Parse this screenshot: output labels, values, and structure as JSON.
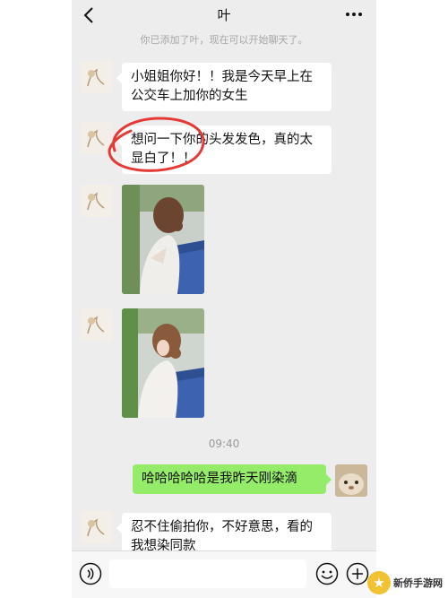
{
  "header": {
    "back_icon": "chevron-left-icon",
    "title": "叶",
    "more_icon": "more-dots-icon"
  },
  "system_notice": "你已添加了叶，现在可以开始聊天了。",
  "messages": [
    {
      "side": "left",
      "type": "text",
      "text": "小姐姐你好！！我是今天早上在公交车上加你的女生"
    },
    {
      "side": "left",
      "type": "text",
      "text": "想问一下你的头发发色，真的太显白了！！"
    },
    {
      "side": "left",
      "type": "image",
      "description_icon": "photo"
    },
    {
      "side": "left",
      "type": "image",
      "description_icon": "photo"
    },
    {
      "side": "right",
      "type": "text",
      "text": "哈哈哈哈哈是我昨天刚染滴"
    },
    {
      "side": "left",
      "type": "text",
      "text": "忍不住偷拍你，不好意思，看的我想染同款"
    }
  ],
  "timestamp": "09:40",
  "input_bar": {
    "voice_icon": "voice-icon",
    "input_value": "",
    "emoji_icon": "emoji-icon",
    "plus_icon": "plus-icon"
  },
  "colors": {
    "background": "#ededed",
    "my_bubble": "#95ec69",
    "their_bubble": "#ffffff",
    "annotation": "#e53935"
  },
  "watermark": {
    "text": "新侨手游网",
    "badge_color": "#f1c232"
  }
}
